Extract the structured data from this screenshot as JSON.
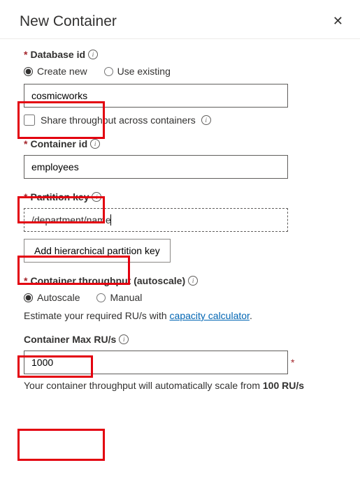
{
  "header": {
    "title": "New Container"
  },
  "database": {
    "label": "Database id",
    "create_new": "Create new",
    "use_existing": "Use existing",
    "value": "cosmicworks",
    "share_label": "Share throughput across containers"
  },
  "container": {
    "label": "Container id",
    "value": "employees"
  },
  "partition": {
    "label": "Partition key",
    "value": "/department/name",
    "add_button": "Add hierarchical partition key"
  },
  "throughput": {
    "label": "Container throughput (autoscale)",
    "autoscale": "Autoscale",
    "manual": "Manual",
    "hint_pre": "Estimate your required RU/s with ",
    "hint_link": "capacity calculator",
    "hint_post": "."
  },
  "max_ru": {
    "label": "Container Max RU/s",
    "value": "1000",
    "footer_pre": "Your container throughput will automatically scale from ",
    "footer_bold": "100 RU/s"
  }
}
